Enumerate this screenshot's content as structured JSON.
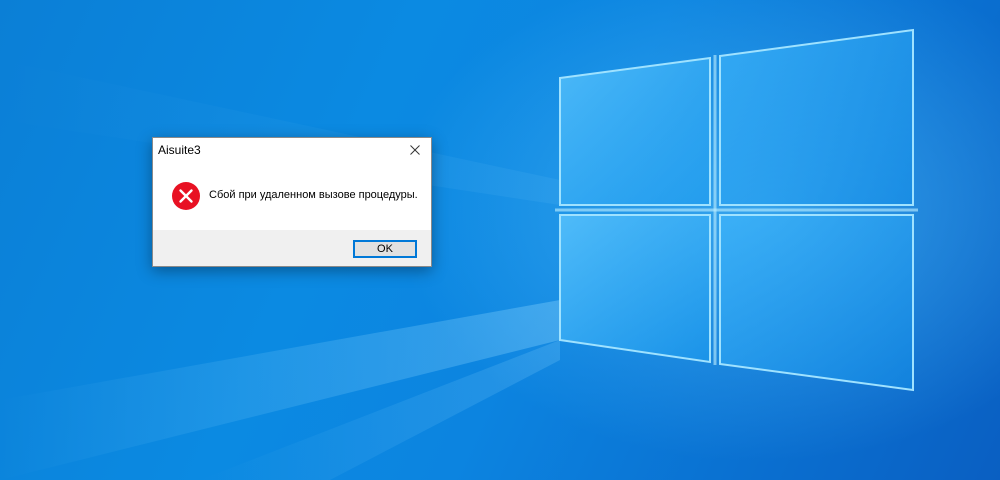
{
  "dialog": {
    "title": "Aisuite3",
    "message": "Сбой при удаленном вызове процедуры.",
    "ok_label": "OK",
    "icon": "error-icon",
    "close_icon": "close-icon"
  },
  "colors": {
    "desktop_blue": "#0b84de",
    "error_red": "#e81123",
    "button_focus": "#0078d7",
    "footer_bg": "#f0f0f0"
  }
}
